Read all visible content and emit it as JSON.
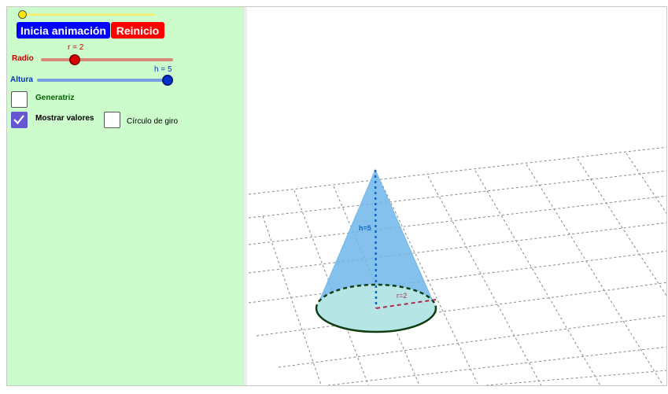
{
  "animation": {
    "progress": 0
  },
  "buttons": {
    "start_label": "Inicia animación",
    "reset_label": "Reinicio"
  },
  "sliders": {
    "radius": {
      "label": "Radio",
      "value_text": "r = 2",
      "value": 2,
      "fraction": 0.22
    },
    "height": {
      "label": "Altura",
      "value_text": "h = 5",
      "value": 5,
      "fraction": 1.0
    }
  },
  "checkboxes": {
    "generatrix": {
      "label": "Generatriz",
      "checked": false
    },
    "show_values": {
      "label": "Mostrar valores",
      "checked": true
    },
    "rotation_circle": {
      "label": "Círculo de giro",
      "checked": false
    }
  },
  "view3d": {
    "height_label": "h=5",
    "radius_label": "r=2"
  },
  "colors": {
    "panel_bg": "#ccfccc",
    "start_button": "#0000ff",
    "reset_button": "#ff0000",
    "radius_color": "#cc0000",
    "height_color": "#0033cc",
    "generatrix_color": "#006600",
    "checkbox_checked": "#6557d2",
    "cone_fill": "#6fb7ea",
    "base_fill": "#bdebe2"
  }
}
